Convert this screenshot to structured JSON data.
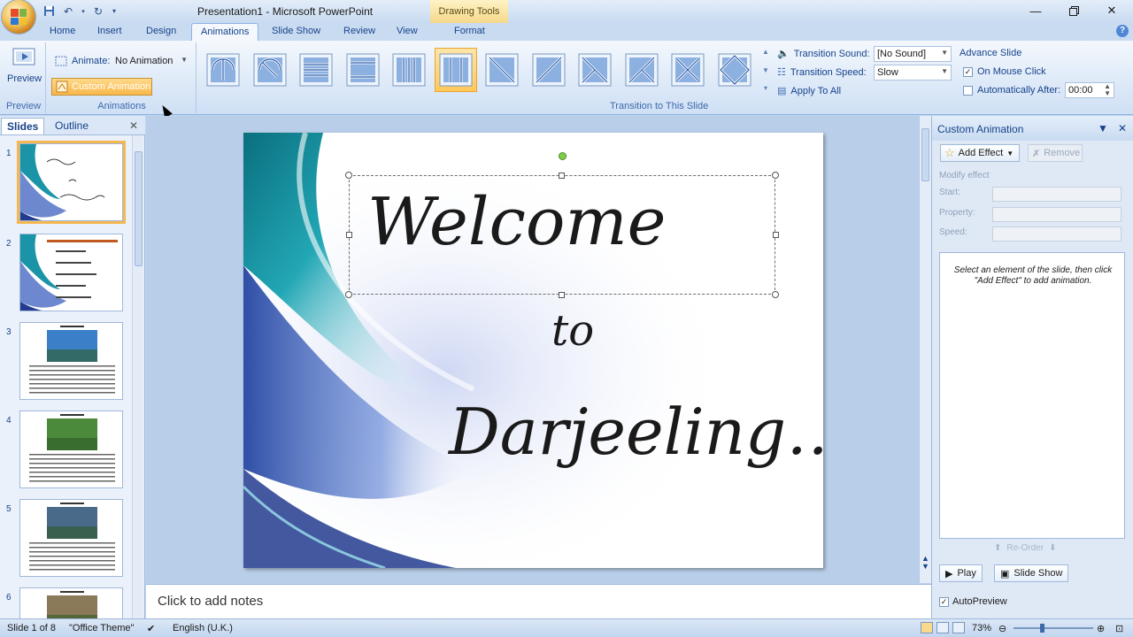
{
  "window": {
    "title": "Presentation1 - Microsoft PowerPoint",
    "context_tab": "Drawing Tools"
  },
  "quick_access": {
    "save_icon": "save-icon",
    "undo_icon": "undo-icon",
    "redo_icon": "redo-icon",
    "customize_icon": "customize-qat-icon"
  },
  "ribbon_tabs": [
    {
      "label": "Home"
    },
    {
      "label": "Insert"
    },
    {
      "label": "Design"
    },
    {
      "label": "Animations",
      "active": true
    },
    {
      "label": "Slide Show"
    },
    {
      "label": "Review"
    },
    {
      "label": "View"
    },
    {
      "label": "Format"
    }
  ],
  "ribbon": {
    "preview_group": {
      "label": "Preview",
      "button": "Preview"
    },
    "animations_group": {
      "label": "Animations",
      "animate_label": "Animate:",
      "animate_value": "No Animation",
      "custom_animation": "Custom Animation"
    },
    "transition_group": {
      "label": "Transition to This Slide",
      "selected_index": 5,
      "sound_label": "Transition Sound:",
      "sound_value": "[No Sound]",
      "speed_label": "Transition Speed:",
      "speed_value": "Slow",
      "apply_all": "Apply To All",
      "advance_label": "Advance Slide",
      "on_mouse_click": "On Mouse Click",
      "on_mouse_click_checked": true,
      "auto_after": "Automatically After:",
      "auto_after_checked": false,
      "auto_after_value": "00:00"
    }
  },
  "slides_pane": {
    "tabs": [
      "Slides",
      "Outline"
    ],
    "slides": [
      {
        "num": "1"
      },
      {
        "num": "2"
      },
      {
        "num": "3"
      },
      {
        "num": "4"
      },
      {
        "num": "5"
      },
      {
        "num": "6"
      }
    ]
  },
  "slide": {
    "line1": "Welcome",
    "line2": "to",
    "line3": "Darjeeling…"
  },
  "notes": {
    "placeholder": "Click to add notes"
  },
  "task_pane": {
    "title": "Custom Animation",
    "add_effect": "Add Effect",
    "remove": "Remove",
    "modify_effect": "Modify effect",
    "start_label": "Start:",
    "property_label": "Property:",
    "speed_label": "Speed:",
    "hint": "Select an element of the slide, then click \"Add Effect\" to add animation.",
    "reorder": "Re-Order",
    "play": "Play",
    "slide_show": "Slide Show",
    "autopreview": "AutoPreview",
    "autopreview_checked": true
  },
  "status_bar": {
    "slide_info": "Slide 1 of 8",
    "theme": "\"Office Theme\"",
    "language": "English (U.K.)",
    "zoom": "73%"
  },
  "colors": {
    "ribbon_bg": "#dde9f8",
    "accent_orange": "#f9b84a",
    "title_text": "#15428b"
  }
}
